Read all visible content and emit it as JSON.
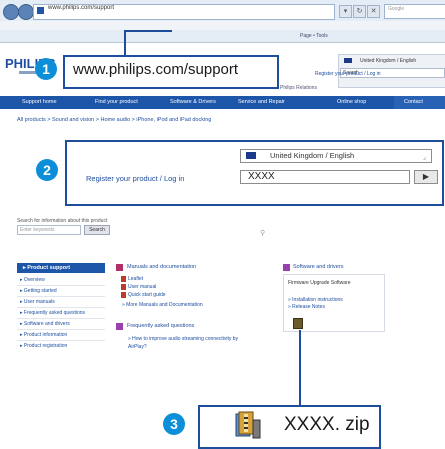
{
  "browser": {
    "url": "www.philips.com/support",
    "search_placeholder": "Google",
    "tools_text": "Page • Tools"
  },
  "header": {
    "logo": "PHILIPS",
    "language": "United Kingdom / English",
    "search_label": "Search",
    "register_small": "Register your product / Log in",
    "relations": "Philips Relations"
  },
  "navbar": {
    "items": [
      "Support home",
      "Find your product",
      "Software & Drivers",
      "Service and Repair",
      "Online shop"
    ],
    "contact": "Contact"
  },
  "breadcrumb": "All products > Sound and vision > Home audio > iPhone, iPod and iPad docking",
  "callout1": {
    "badge": "1",
    "url": "www.philips.com/support"
  },
  "callout2": {
    "badge": "2",
    "language": "United Kingdom / English",
    "register_label": "Register your product / Log in",
    "input_value": "XXXX",
    "go_icon": "play-arrow-icon",
    "go_glyph": "▶"
  },
  "search": {
    "label": "Search for information about this product",
    "placeholder": "Enter keywords",
    "button": "Search"
  },
  "left_nav": {
    "title": "▸ Product support",
    "items": [
      "▸ Overview",
      "▸ Getting started",
      "▸ User manuals",
      "▸ Frequently asked questions",
      "▸ Software and drivers",
      "▸ Product information",
      "▸ Product registration"
    ]
  },
  "manuals": {
    "title": "Manuals and documentation",
    "items": [
      "Leaflet",
      "User manual",
      "Quick start guide"
    ],
    "more": "» More Manuals and Documentation"
  },
  "faq": {
    "title": "Frequently asked questions",
    "items": [
      "» How to improve audio streaming connectivity by AirPlay?"
    ]
  },
  "software": {
    "title": "Software and drivers",
    "firmware": "Firmware Upgrade Software",
    "links": [
      "» Installation instructions",
      "» Release Notes"
    ]
  },
  "callout3": {
    "badge": "3",
    "file": "XXXX. zip",
    "icon": "zip-archive-icon"
  },
  "colors": {
    "accent": "#1d56a8",
    "badge": "#0d8ed8",
    "callout_border": "#1d4e9c"
  }
}
